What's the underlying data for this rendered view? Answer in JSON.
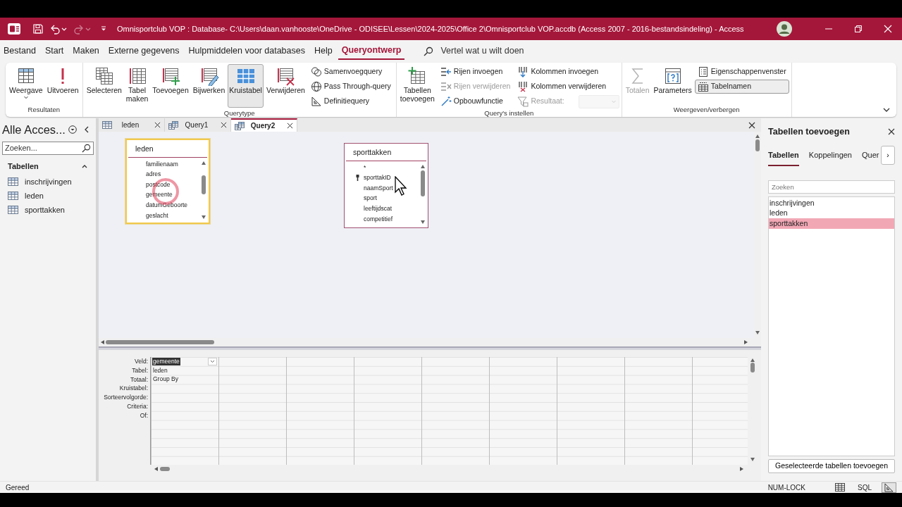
{
  "title_bar": {
    "title": "Omnisportclub VOP : Database- C:\\Users\\daan.vanhooste\\OneDrive - ODISEE\\Lessen\\2024-2025\\Office 2\\Omnisportclub VOP.accdb (Access 2007 - 2016-bestandsindeling) - Access",
    "redo_disabled": true
  },
  "menu_tabs": [
    {
      "label": "Bestand",
      "selected": false
    },
    {
      "label": "Start",
      "selected": false
    },
    {
      "label": "Maken",
      "selected": false
    },
    {
      "label": "Externe gegevens",
      "selected": false
    },
    {
      "label": "Hulpmiddelen voor databases",
      "selected": false
    },
    {
      "label": "Help",
      "selected": false
    },
    {
      "label": "Queryontwerp",
      "selected": true
    }
  ],
  "tell_me": {
    "placeholder": "Vertel wat u wilt doen"
  },
  "ribbon": {
    "groups": [
      {
        "label": "Resultaten",
        "items": [
          {
            "kind": "large",
            "label": "Weergave",
            "dropdown": true,
            "disabled": false,
            "selected": false
          },
          {
            "kind": "large",
            "label": "Uitvoeren",
            "dropdown": false,
            "disabled": false,
            "selected": false
          }
        ]
      },
      {
        "label": "Querytype",
        "items": [
          {
            "kind": "large",
            "label": "Selecteren",
            "dropdown": false,
            "disabled": false,
            "selected": false
          },
          {
            "kind": "large",
            "label": "Tabel\nmaken",
            "dropdown": false,
            "disabled": false,
            "selected": false
          },
          {
            "kind": "large",
            "label": "Toevoegen",
            "dropdown": false,
            "disabled": false,
            "selected": false
          },
          {
            "kind": "large",
            "label": "Bijwerken",
            "dropdown": false,
            "disabled": false,
            "selected": false
          },
          {
            "kind": "large",
            "label": "Kruistabel",
            "dropdown": false,
            "disabled": false,
            "selected": true
          },
          {
            "kind": "large",
            "label": "Verwijderen",
            "dropdown": false,
            "disabled": false,
            "selected": false
          },
          {
            "kind": "column",
            "items": [
              {
                "kind": "button",
                "label": "Samenvoegquery",
                "disabled": false,
                "selected": false
              },
              {
                "kind": "button",
                "label": "Pass Through-query",
                "disabled": false,
                "selected": false
              },
              {
                "kind": "button",
                "label": "Definitiequery",
                "disabled": false,
                "selected": false
              }
            ]
          }
        ]
      },
      {
        "label": "Query's instellen",
        "items": [
          {
            "kind": "large",
            "label": "Tabellen\ntoevoegen",
            "dropdown": false,
            "disabled": false,
            "selected": false
          },
          {
            "kind": "column",
            "items": [
              {
                "kind": "button",
                "label": "Rijen invoegen",
                "disabled": false,
                "selected": false
              },
              {
                "kind": "button",
                "label": "Rijen verwijderen",
                "disabled": true,
                "selected": false
              },
              {
                "kind": "button",
                "label": "Opbouwfunctie",
                "disabled": false,
                "selected": false
              }
            ]
          },
          {
            "kind": "column",
            "items": [
              {
                "kind": "button",
                "label": "Kolommen invoegen",
                "disabled": false,
                "selected": false
              },
              {
                "kind": "button",
                "label": "Kolommen verwijderen",
                "disabled": false,
                "selected": false
              },
              {
                "kind": "combo",
                "label": "Resultaat:",
                "disabled": true
              }
            ]
          }
        ]
      },
      {
        "label": "Weergeven/verbergen",
        "items": [
          {
            "kind": "large",
            "label": "Totalen",
            "dropdown": false,
            "disabled": true,
            "selected": false
          },
          {
            "kind": "large",
            "label": "Parameters",
            "dropdown": false,
            "disabled": false,
            "selected": false
          },
          {
            "kind": "column",
            "items": [
              {
                "kind": "button",
                "label": "Eigenschappenvenster",
                "disabled": false,
                "selected": false
              },
              {
                "kind": "button",
                "label": "Tabelnamen",
                "disabled": false,
                "selected": true
              }
            ]
          }
        ]
      }
    ]
  },
  "navigation_pane": {
    "title": "Alle Acces...",
    "search": {
      "placeholder": "Zoeken..."
    },
    "sections": [
      {
        "label": "Tabellen",
        "expanded": true,
        "items": [
          {
            "label": "inschrijvingen"
          },
          {
            "label": "leden"
          },
          {
            "label": "sporttakken"
          }
        ]
      }
    ]
  },
  "document_tabs": [
    {
      "label": "leden",
      "kind": "table",
      "selected": false
    },
    {
      "label": "Query1",
      "kind": "query",
      "selected": false
    },
    {
      "label": "Query2",
      "kind": "query",
      "selected": true
    }
  ],
  "design_tables": [
    {
      "name": "leden",
      "selected": true,
      "fields": [
        {
          "name": "familienaam",
          "key": false
        },
        {
          "name": "adres",
          "key": false
        },
        {
          "name": "postcode",
          "key": false
        },
        {
          "name": "gemeente",
          "key": false
        },
        {
          "name": "datumGeboorte",
          "key": false
        },
        {
          "name": "geslacht",
          "key": false
        }
      ]
    },
    {
      "name": "sporttakken",
      "selected": false,
      "fields": [
        {
          "name": "*",
          "key": false
        },
        {
          "name": "sporttakID",
          "key": true
        },
        {
          "name": "naamSport",
          "key": false
        },
        {
          "name": "sport",
          "key": false
        },
        {
          "name": "leeftijdscat",
          "key": false
        },
        {
          "name": "competitief",
          "key": false
        }
      ]
    }
  ],
  "design_grid": {
    "rows": [
      {
        "label": "Veld:",
        "cells": [
          {
            "text": "gemeente",
            "selected": true,
            "dropdown": true
          }
        ]
      },
      {
        "label": "Tabel:",
        "cells": [
          {
            "text": "leden",
            "selected": false,
            "dropdown": false
          }
        ]
      },
      {
        "label": "Totaal:",
        "cells": [
          {
            "text": "Group By",
            "selected": false,
            "dropdown": false
          }
        ]
      },
      {
        "label": "Kruistabel:"
      },
      {
        "label": "Sorteervolgorde:"
      },
      {
        "label": "Criteria:"
      },
      {
        "label": "Of:"
      }
    ]
  },
  "add_tables_pane": {
    "title": "Tabellen toevoegen",
    "tabs": [
      {
        "label": "Tabellen",
        "selected": true
      },
      {
        "label": "Koppelingen",
        "selected": false
      },
      {
        "label": "Quer",
        "selected": false
      }
    ],
    "more": "›",
    "search": {
      "placeholder": "Zoeken"
    },
    "items": [
      {
        "label": "inschrijvingen",
        "selected": false
      },
      {
        "label": "leden",
        "selected": false
      },
      {
        "label": "sporttakken",
        "selected": true
      }
    ],
    "button": "Geselecteerde tabellen toevoegen"
  },
  "status_bar": {
    "text": "Gereed",
    "indicators": [
      "NUM-LOCK"
    ],
    "views": [
      {
        "kind": "datasheet",
        "selected": false
      },
      {
        "kind": "sql",
        "label": "SQL",
        "selected": false
      },
      {
        "kind": "design",
        "selected": true
      }
    ]
  }
}
